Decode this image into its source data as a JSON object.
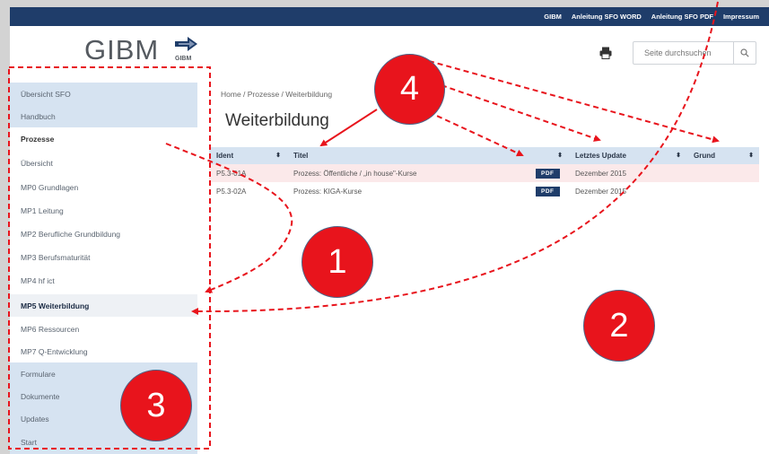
{
  "topnav": [
    "GIBM",
    "Anleitung SFO WORD",
    "Anleitung SFO PDF",
    "Impressum"
  ],
  "logo": {
    "text": "GIBM",
    "sub": "GIBM"
  },
  "search": {
    "placeholder": "Seite durchsuchen"
  },
  "sidebar": {
    "items": [
      {
        "label": "Übersicht SFO"
      },
      {
        "label": "Handbuch"
      },
      {
        "label": "Prozesse"
      },
      {
        "label": "Übersicht"
      },
      {
        "label": "MP0 Grundlagen"
      },
      {
        "label": "MP1 Leitung"
      },
      {
        "label": "MP2 Berufliche Grundbildung"
      },
      {
        "label": "MP3 Berufsmaturität"
      },
      {
        "label": "MP4 hf ict"
      },
      {
        "label": "MP5 Weiterbildung"
      },
      {
        "label": "MP6 Ressourcen"
      },
      {
        "label": "MP7 Q-Entwicklung"
      },
      {
        "label": "Formulare"
      },
      {
        "label": "Dokumente"
      },
      {
        "label": "Updates"
      },
      {
        "label": "Start"
      }
    ]
  },
  "breadcrumb": "Home / Prozesse / Weiterbildung",
  "page_title": "Weiterbildung",
  "table": {
    "headers": [
      "Ident",
      "Titel",
      "Letztes Update",
      "Grund"
    ],
    "sort_glyph": "⬍",
    "rows": [
      {
        "ident": "P5.3-01A",
        "title": "Prozess: Öffentliche / „in house\"-Kurse",
        "pdf": "PDF",
        "update": "Dezember 2015",
        "grund": ""
      },
      {
        "ident": "P5.3-02A",
        "title": "Prozess: KIGA-Kurse",
        "pdf": "PDF",
        "update": "Dezember 2015",
        "grund": ""
      }
    ]
  },
  "annotations": {
    "badge1": "1",
    "badge2": "2",
    "badge3": "3",
    "badge4": "4",
    "accent": "#e8141c"
  }
}
